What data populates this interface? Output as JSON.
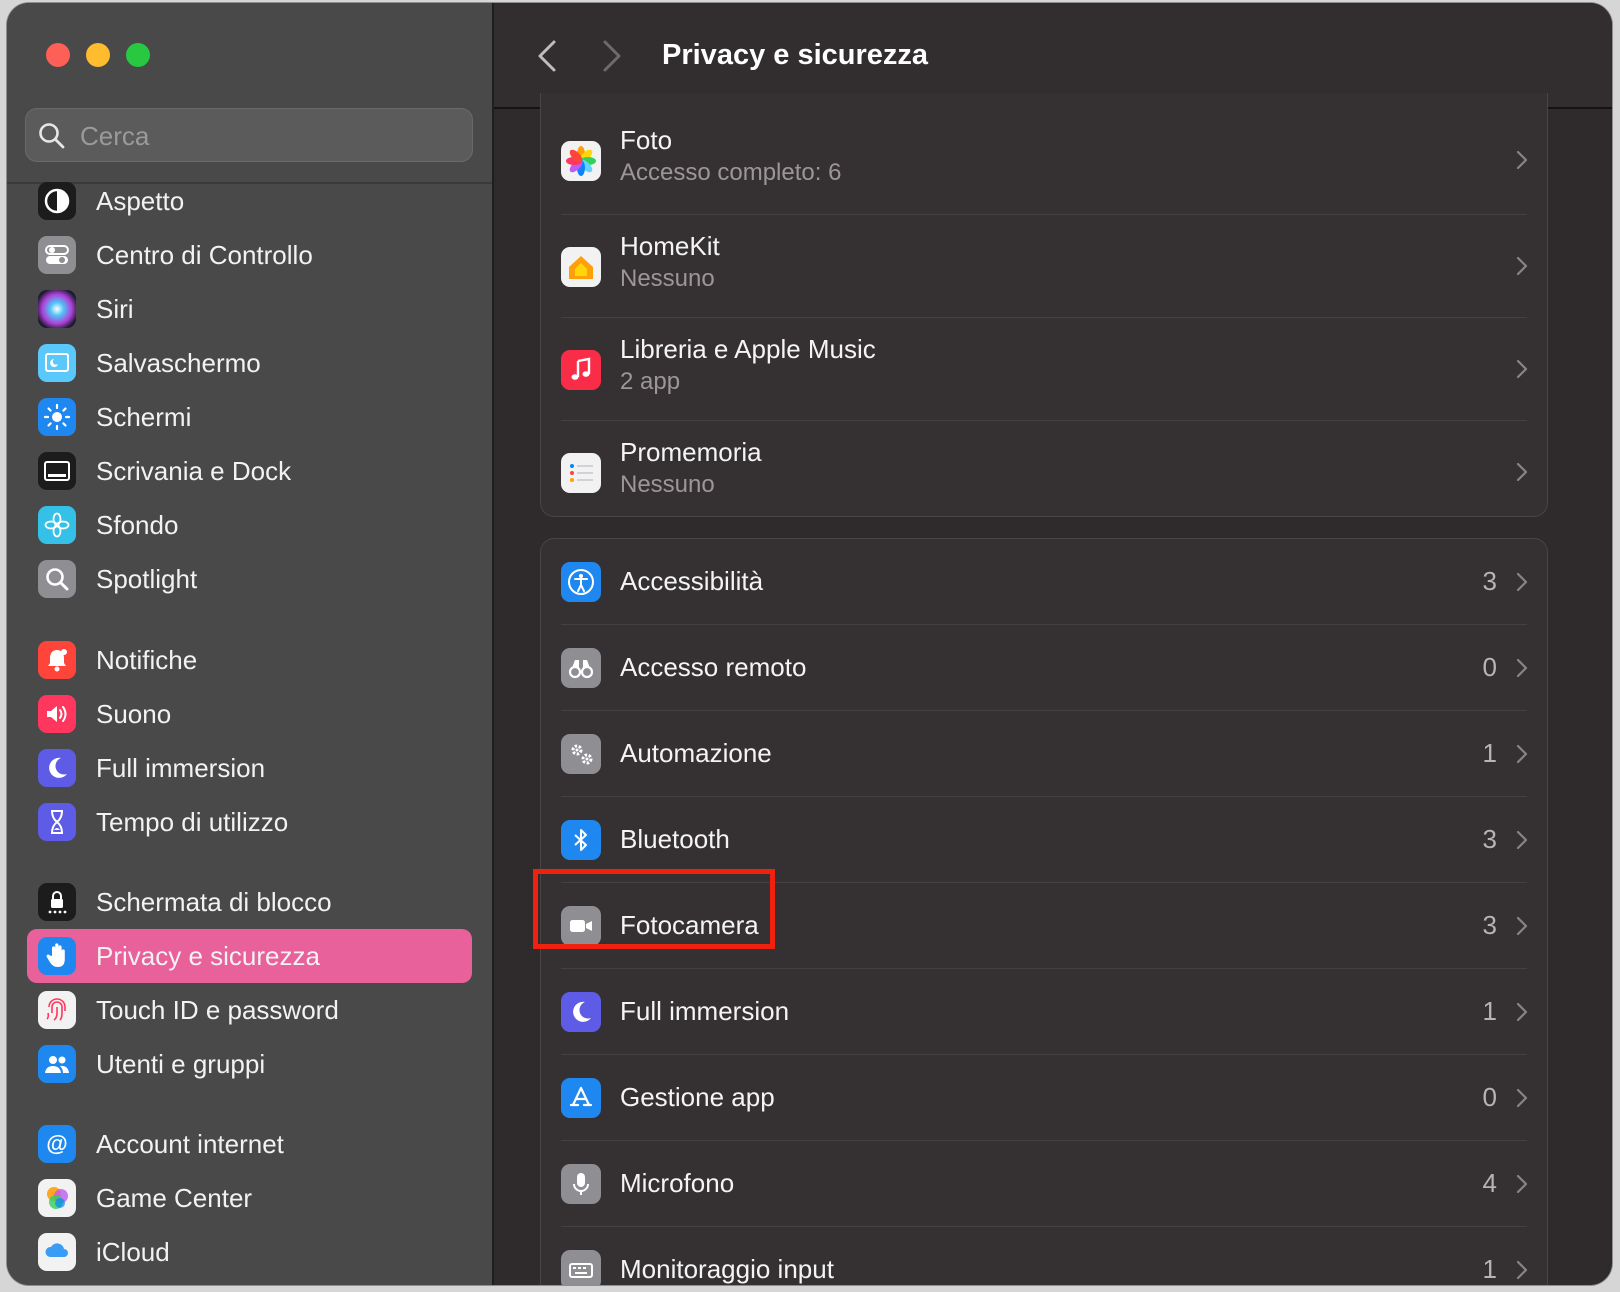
{
  "window": {
    "title": "Privacy e sicurezza"
  },
  "search": {
    "placeholder": "Cerca"
  },
  "sidebar": {
    "items": [
      {
        "label": "Aspetto",
        "icon": "appearance-icon"
      },
      {
        "label": "Centro di Controllo",
        "icon": "control-center-icon"
      },
      {
        "label": "Siri",
        "icon": "siri-icon"
      },
      {
        "label": "Salvaschermo",
        "icon": "screensaver-icon"
      },
      {
        "label": "Schermi",
        "icon": "displays-icon"
      },
      {
        "label": "Scrivania e Dock",
        "icon": "desktop-dock-icon"
      },
      {
        "label": "Sfondo",
        "icon": "wallpaper-icon"
      },
      {
        "label": "Spotlight",
        "icon": "spotlight-icon"
      },
      {
        "label": "Notifiche",
        "icon": "notifications-icon"
      },
      {
        "label": "Suono",
        "icon": "sound-icon"
      },
      {
        "label": "Full immersion",
        "icon": "focus-icon"
      },
      {
        "label": "Tempo di utilizzo",
        "icon": "screen-time-icon"
      },
      {
        "label": "Schermata di blocco",
        "icon": "lock-screen-icon"
      },
      {
        "label": "Privacy e sicurezza",
        "icon": "privacy-hand-icon",
        "selected": true
      },
      {
        "label": "Touch ID e password",
        "icon": "touch-id-icon"
      },
      {
        "label": "Utenti e gruppi",
        "icon": "users-groups-icon"
      },
      {
        "label": "Account internet",
        "icon": "internet-accounts-icon"
      },
      {
        "label": "Game Center",
        "icon": "game-center-icon"
      },
      {
        "label": "iCloud",
        "icon": "icloud-icon"
      }
    ]
  },
  "main": {
    "group1": [
      {
        "title": "Foto",
        "subtitle": "Accesso completo: 6",
        "icon": "photos-icon"
      },
      {
        "title": "HomeKit",
        "subtitle": "Nessuno",
        "icon": "homekit-icon"
      },
      {
        "title": "Libreria e Apple Music",
        "subtitle": "2 app",
        "icon": "music-icon"
      },
      {
        "title": "Promemoria",
        "subtitle": "Nessuno",
        "icon": "reminders-icon"
      }
    ],
    "group2": [
      {
        "title": "Accessibilità",
        "count": "3",
        "icon": "accessibility-icon"
      },
      {
        "title": "Accesso remoto",
        "count": "0",
        "icon": "remote-access-icon"
      },
      {
        "title": "Automazione",
        "count": "1",
        "icon": "automation-icon"
      },
      {
        "title": "Bluetooth",
        "count": "3",
        "icon": "bluetooth-icon"
      },
      {
        "title": "Fotocamera",
        "count": "3",
        "icon": "camera-icon",
        "highlighted": true
      },
      {
        "title": "Full immersion",
        "count": "1",
        "icon": "focus-icon"
      },
      {
        "title": "Gestione app",
        "count": "0",
        "icon": "app-management-icon"
      },
      {
        "title": "Microfono",
        "count": "4",
        "icon": "microphone-icon"
      },
      {
        "title": "Monitoraggio input",
        "count": "1",
        "icon": "input-monitoring-icon"
      }
    ]
  },
  "colors": {
    "sidebar_bg": "#494949",
    "main_bg": "#2f2a2b",
    "selection": "#e8619a",
    "highlight_box": "#f0220f"
  }
}
